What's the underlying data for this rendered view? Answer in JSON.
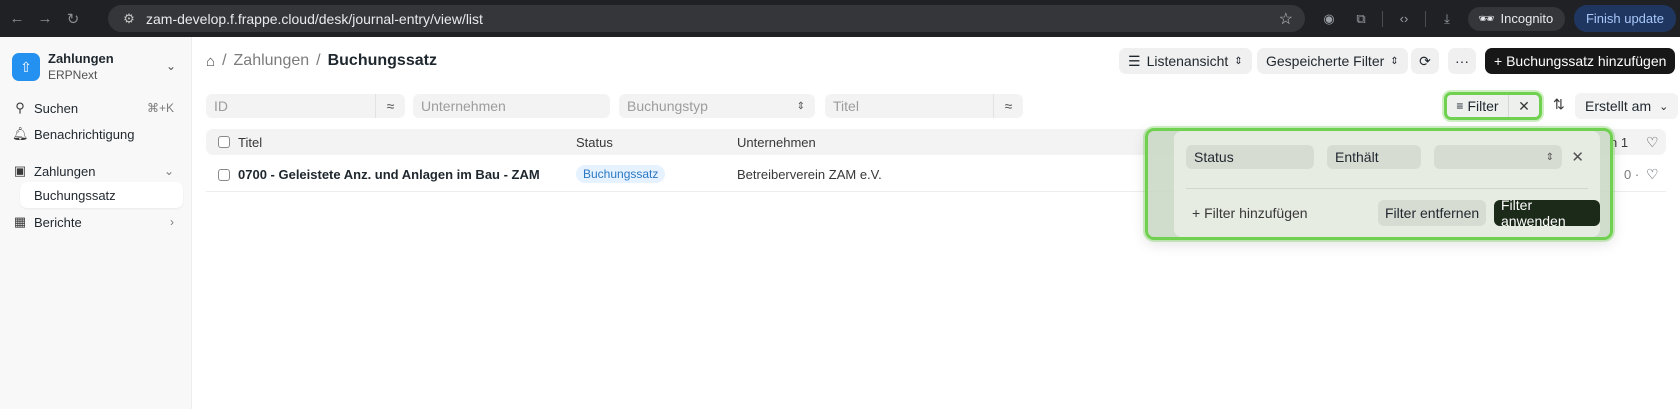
{
  "browser": {
    "url": "zam-develop.f.frappe.cloud/desk/journal-entry/view/list",
    "incognito_label": "Incognito",
    "finish_update_label": "Finish update"
  },
  "sidebar": {
    "app_name": "Zahlungen",
    "app_subtitle": "ERPNext",
    "search_label": "Suchen",
    "search_shortcut": "⌘+K",
    "notifications_label": "Benachrichtigung",
    "section_label": "Zahlungen",
    "active_item_label": "Buchungssatz",
    "reports_label": "Berichte"
  },
  "header": {
    "breadcrumb_parent": "Zahlungen",
    "breadcrumb_separator": "/",
    "title": "Buchungssatz",
    "view_switcher_label": "Listenansicht",
    "saved_filters_label": "Gespeicherte Filter",
    "more_label": "···",
    "add_label": "+ Buchungssatz hinzufügen"
  },
  "filters": {
    "id_placeholder": "ID",
    "company_placeholder": "Unternehmen",
    "type_placeholder": "Buchungstyp",
    "title_placeholder": "Titel",
    "like_symbol": "≈",
    "filter_button_label": "Filter",
    "sort_label": "Erstellt am"
  },
  "list": {
    "columns": {
      "title": "Titel",
      "status": "Status",
      "company": "Unternehmen",
      "count_fragment": "n 1"
    },
    "rows": [
      {
        "title": "0700 - Geleistete Anz. und Anlagen im Bau - ZAM",
        "status": "Buchungssatz",
        "company": "Betreiberverein ZAM e.V.",
        "right_fragment": "0 ·"
      }
    ]
  },
  "filter_popover": {
    "field": "Status",
    "condition": "Enthält",
    "value": "",
    "add_filter_label": "+ Filter hinzufügen",
    "remove_filters_label": "Filter entfernen",
    "apply_filters_label": "Filter anwenden"
  },
  "colors": {
    "highlight": "#6fd14f",
    "primary_button": "#171717",
    "badge_text": "#2b78c4"
  }
}
